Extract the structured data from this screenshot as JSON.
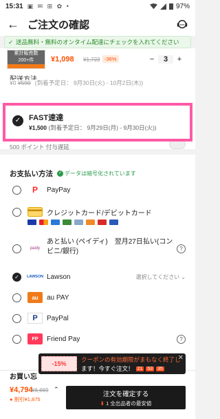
{
  "status": {
    "time": "15:31",
    "icons": "▣ ✉ ⊞ ✿ •",
    "battery": "97%"
  },
  "header": {
    "title": "ご注文の確認"
  },
  "notice": {
    "text": "送品無料・無料のオンタイム配達にチェックを入れてください"
  },
  "product": {
    "badge_line1": "累計販売数",
    "badge_line2": "200+件",
    "price": "¥1,098",
    "old_price": "¥1,723",
    "discount": "-36%",
    "qty": "3"
  },
  "shipping": {
    "section_label": "配送方法",
    "standard": {
      "price": "¥0",
      "old_price": "¥590",
      "eta": "(到着予定日： 9月30日(火) - 10月2日(木))"
    },
    "fast": {
      "name": "FAST速達",
      "price": "¥1,500",
      "eta": "(到着予定日： 9月29日(月) - 9月30日(火))"
    },
    "third": {
      "points": "500 ポイント 付与遅延"
    }
  },
  "payment": {
    "title": "お支払い方法",
    "encrypted": "データは暗号化されています",
    "methods": [
      {
        "label": "PayPay",
        "logo": "P"
      },
      {
        "label": "クレジットカード/デビットカード",
        "logo": "card"
      },
      {
        "label": "あと払い (ペイディ)　翌月27日払い(コン",
        "label2": "ビニ/銀行)",
        "logo": "paidy"
      },
      {
        "label": "Lawson",
        "logo": "LAWSON",
        "hint": "選択してください ⌄"
      },
      {
        "label": "au PAY",
        "logo": "au"
      },
      {
        "label": "PayPal",
        "logo": "P"
      },
      {
        "label": "Friend Pay",
        "logo": "FP"
      }
    ]
  },
  "bottom": {
    "section": "お買い忘",
    "total": "¥4,794",
    "total_old": "¥6,669",
    "saved": "● 割引¥1,875",
    "confirm_line1": "注文を確定する",
    "confirm_line2": "1 全出品者の最安値"
  },
  "coupon": {
    "discount": "-15%",
    "line1": "クーポンの有効期限がまもなく終了し",
    "line2": "ます！今すぐ注文！",
    "h": "21",
    "m": "53",
    "s": "35"
  }
}
